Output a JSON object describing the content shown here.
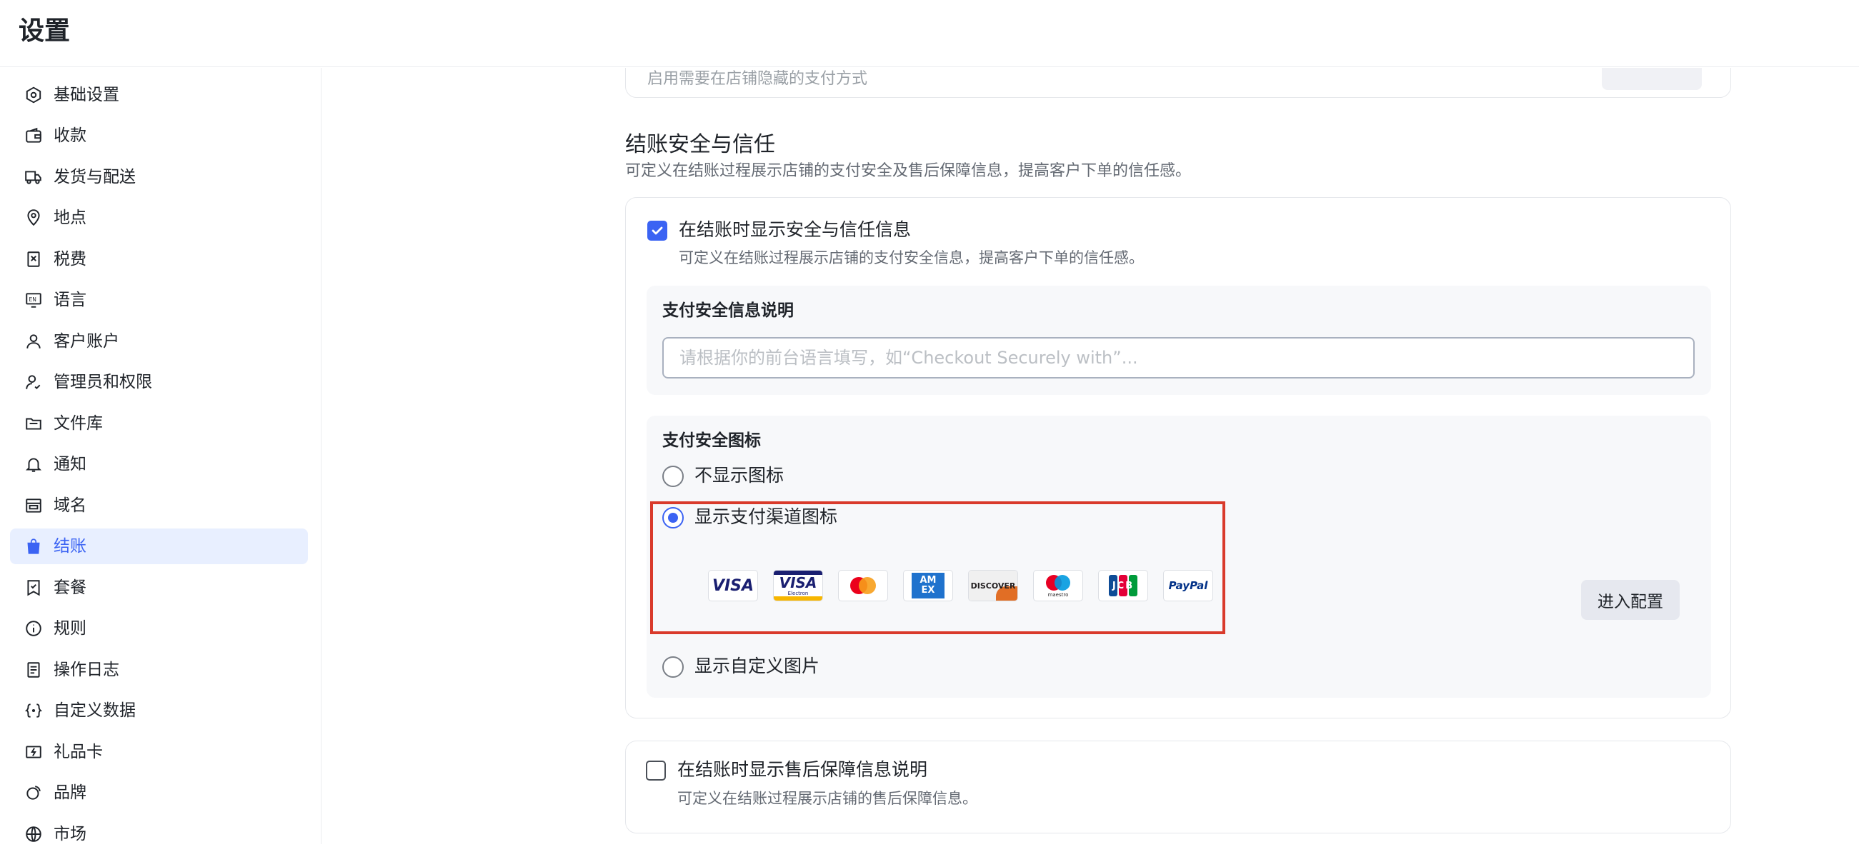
{
  "header": {
    "title": "设置"
  },
  "sidebar": {
    "items": [
      {
        "label": "基础设置",
        "icon": "settings-hex-icon"
      },
      {
        "label": "收款",
        "icon": "wallet-icon"
      },
      {
        "label": "发货与配送",
        "icon": "truck-icon"
      },
      {
        "label": "地点",
        "icon": "location-pin-icon"
      },
      {
        "label": "税费",
        "icon": "tax-receipt-icon"
      },
      {
        "label": "语言",
        "icon": "language-icon"
      },
      {
        "label": "客户账户",
        "icon": "user-icon"
      },
      {
        "label": "管理员和权限",
        "icon": "user-permission-icon"
      },
      {
        "label": "文件库",
        "icon": "folder-icon"
      },
      {
        "label": "通知",
        "icon": "bell-icon"
      },
      {
        "label": "域名",
        "icon": "domain-icon"
      },
      {
        "label": "结账",
        "icon": "shopping-bag-icon",
        "active": true
      },
      {
        "label": "套餐",
        "icon": "plan-icon"
      },
      {
        "label": "规则",
        "icon": "info-icon"
      },
      {
        "label": "操作日志",
        "icon": "log-icon"
      },
      {
        "label": "自定义数据",
        "icon": "custom-data-icon"
      },
      {
        "label": "礼品卡",
        "icon": "gift-card-icon"
      },
      {
        "label": "品牌",
        "icon": "brand-icon"
      },
      {
        "label": "市场",
        "icon": "globe-icon"
      }
    ]
  },
  "top_card": {
    "desc": "启用需要在店铺隐藏的支付方式"
  },
  "trust": {
    "title": "结账安全与信任",
    "desc": "可定义在结账过程展示店铺的支付安全及售后保障信息，提高客户下单的信任感。",
    "show_security": {
      "label": "在结账时显示安全与信任信息",
      "desc": "可定义在结账过程展示店铺的支付安全信息，提高客户下单的信任感。",
      "checked": true
    },
    "security_text": {
      "title": "支付安全信息说明",
      "placeholder": "请根据你的前台语言填写，如“Checkout Securely with”..."
    },
    "icons": {
      "title": "支付安全图标",
      "options": [
        "不显示图标",
        "显示支付渠道图标",
        "显示自定义图片"
      ],
      "selected_index": 1,
      "config_button": "进入配置",
      "payment_icons": [
        {
          "name": "visa",
          "text": "VISA"
        },
        {
          "name": "visa-electron",
          "text": "VISA",
          "sub": "Electron"
        },
        {
          "name": "mastercard",
          "text": ""
        },
        {
          "name": "amex",
          "text": "AM EX"
        },
        {
          "name": "discover",
          "text": "DISCOVER"
        },
        {
          "name": "maestro",
          "text": "maestro"
        },
        {
          "name": "jcb",
          "text": "JCB"
        },
        {
          "name": "paypal",
          "text": "PayPal"
        }
      ]
    },
    "after_sales": {
      "label": "在结账时显示售后保障信息说明",
      "desc": "可定义在结账过程展示店铺的售后保障信息。",
      "checked": false
    }
  },
  "colors": {
    "accent": "#3b63f3",
    "highlight": "#d93a2b",
    "active_bg": "#e8efff"
  }
}
